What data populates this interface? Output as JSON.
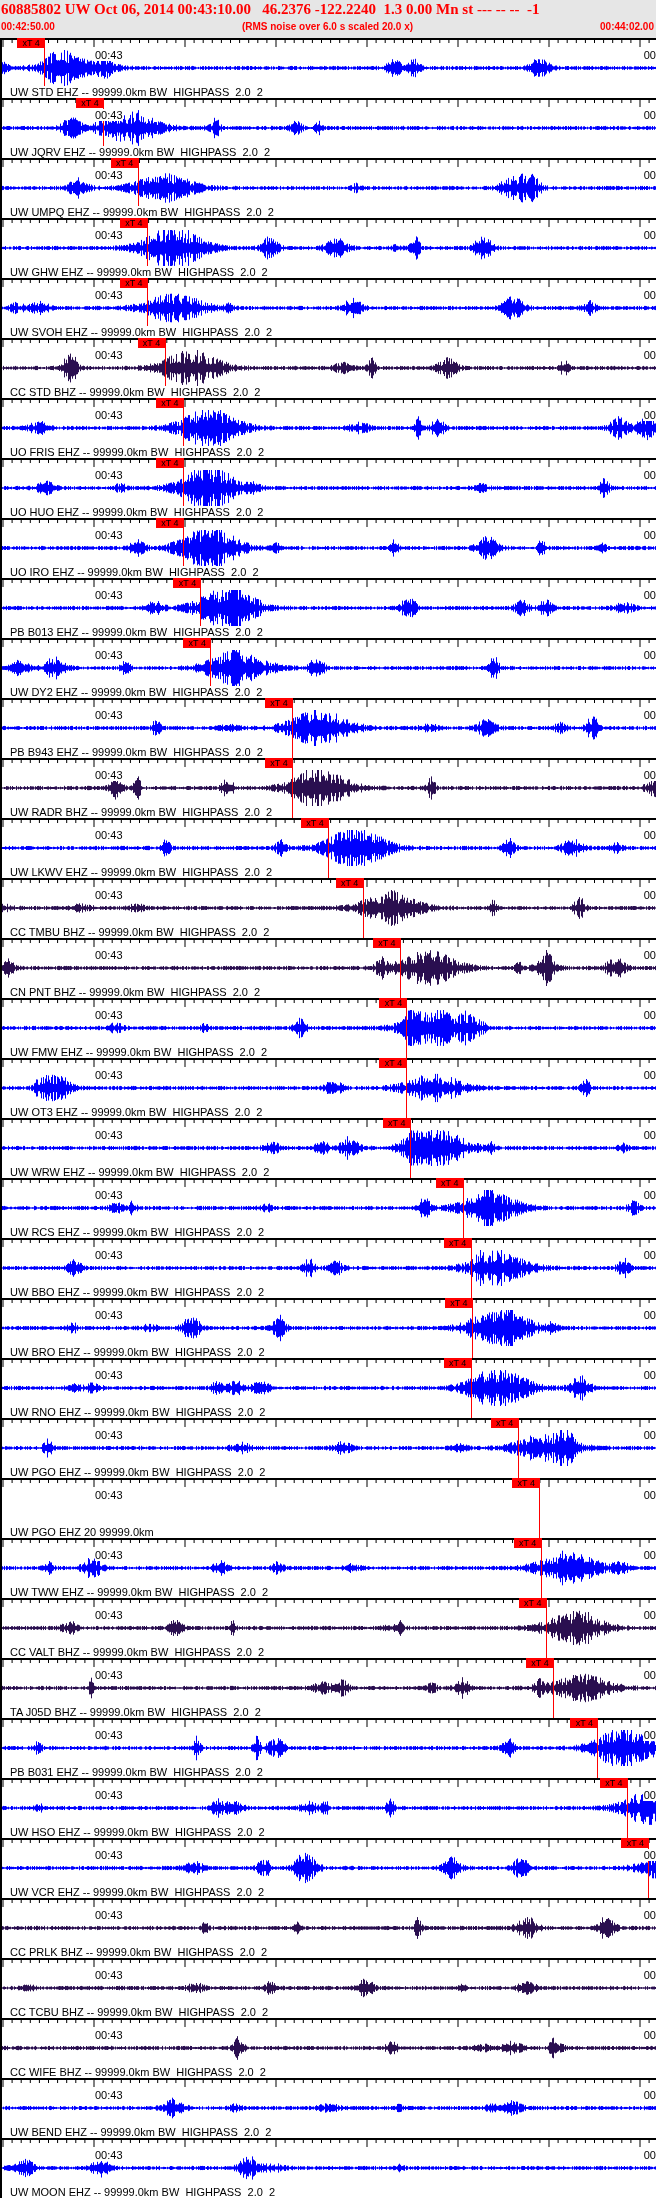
{
  "header": {
    "title": "60885802 UW Oct 06, 2014 00:43:10.00   46.2376 -122.2240  1.3 0.00 Mn st --- -- --  -1",
    "start_time": "00:42:50.00",
    "note": "(RMS noise over 6.0 s scaled 20.0 x)",
    "end_time": "00:44:02.00"
  },
  "traces": [
    {
      "label": "UW STD EHZ -- 99999.0km BW  HIGHPASS  2.0  2",
      "time_label": "00:43",
      "edge_label": "00",
      "kind": "wave",
      "color": "#0000ff",
      "pick": "xT 4",
      "level": 0.066
    },
    {
      "label": "UW JQRV EHZ -- 99999.0km BW  HIGHPASS  2.0  2",
      "time_label": "00:43",
      "edge_label": "00",
      "kind": "wave",
      "color": "#0000ff",
      "pick": "xT 4",
      "level": 0.156
    },
    {
      "label": "UW UMPQ EHZ -- 99999.0km BW  HIGHPASS  2.0  2",
      "time_label": "00:43",
      "edge_label": "00",
      "kind": "wave",
      "color": "#0000ff",
      "pick": "xT 4",
      "level": 0.209
    },
    {
      "label": "UW GHW EHZ -- 99999.0km BW  HIGHPASS  2.0  2",
      "time_label": "00:43",
      "edge_label": "00",
      "kind": "wave",
      "color": "#0000ff",
      "pick": "xT 4",
      "level": 0.223
    },
    {
      "label": "UW SVOH EHZ -- 99999.0km BW  HIGHPASS  2.0  2",
      "time_label": "00:43",
      "edge_label": "00",
      "kind": "wave",
      "color": "#0000ff",
      "pick": "xT 4",
      "level": 0.223
    },
    {
      "label": "CC STD BHZ -- 99999.0km BW  HIGHPASS  2.0  2",
      "time_label": "00:43",
      "edge_label": "00",
      "kind": "wave",
      "color": "#2a0f50",
      "pick": "xT 4",
      "level": 0.25
    },
    {
      "label": "UO FRIS EHZ -- 99999.0km BW  HIGHPASS  2.0  2",
      "time_label": "00:43",
      "edge_label": "00",
      "kind": "wave",
      "color": "#0000ff",
      "pick": "xT 4",
      "level": 0.278
    },
    {
      "label": "UO HUO EHZ -- 99999.0km BW  HIGHPASS  2.0  2",
      "time_label": "00:43",
      "edge_label": "00",
      "kind": "wave",
      "color": "#0000ff",
      "pick": "xT 4",
      "level": 0.278
    },
    {
      "label": "UO IRO EHZ -- 99999.0km BW  HIGHPASS  2.0  2",
      "time_label": "00:43",
      "edge_label": "00",
      "kind": "wave",
      "color": "#0000ff",
      "pick": "xT 4",
      "level": 0.278
    },
    {
      "label": "PB B013 EHZ -- 99999.0km BW  HIGHPASS  2.0  2",
      "time_label": "00:43",
      "edge_label": "00",
      "kind": "wave",
      "color": "#0000ff",
      "pick": "xT 4",
      "level": 0.305
    },
    {
      "label": "UW DY2 EHZ -- 99999.0km BW  HIGHPASS  2.0  2",
      "time_label": "00:43",
      "edge_label": "00",
      "kind": "wave",
      "color": "#0000ff",
      "pick": "xT 4",
      "level": 0.32
    },
    {
      "label": "PB B943 EHZ -- 99999.0km BW  HIGHPASS  2.0  2",
      "time_label": "00:43",
      "edge_label": "00",
      "kind": "wave",
      "color": "#0000ff",
      "pick": "xT 4",
      "level": 0.445
    },
    {
      "label": "UW RADR BHZ -- 99999.0km BW  HIGHPASS  2.0  2",
      "time_label": "00:43",
      "edge_label": "00",
      "kind": "wave",
      "color": "#2a0f50",
      "pick": "xT 4",
      "level": 0.445
    },
    {
      "label": "UW LKWV EHZ -- 99999.0km BW  HIGHPASS  2.0  2",
      "time_label": "00:43",
      "edge_label": "00",
      "kind": "wave",
      "color": "#0000ff",
      "pick": "xT 4",
      "level": 0.5
    },
    {
      "label": "CC TMBU BHZ -- 99999.0km BW  HIGHPASS  2.0  2",
      "time_label": "00:43",
      "edge_label": "00",
      "kind": "wave",
      "color": "#2a0f50",
      "pick": "xT 4",
      "level": 0.553
    },
    {
      "label": "CN PNT BHZ -- 99999.0km BW  HIGHPASS  2.0  2",
      "time_label": "00:43",
      "edge_label": "00",
      "kind": "wave",
      "color": "#2a0f50",
      "pick": "xT 4",
      "level": 0.61
    },
    {
      "label": "UW FMW EHZ -- 99999.0km BW  HIGHPASS  2.0  2",
      "time_label": "00:43",
      "edge_label": "00",
      "kind": "wave",
      "color": "#0000ff",
      "pick": "xT 4",
      "level": 0.62
    },
    {
      "label": "UW OT3 EHZ -- 99999.0km BW  HIGHPASS  2.0  2",
      "time_label": "00:43",
      "edge_label": "00",
      "kind": "wave",
      "color": "#0000ff",
      "pick": "xT 4",
      "level": 0.62
    },
    {
      "label": "UW WRW EHZ -- 99999.0km BW  HIGHPASS  2.0  2",
      "time_label": "00:43",
      "edge_label": "00",
      "kind": "wave",
      "color": "#0000ff",
      "pick": "xT 4",
      "level": 0.625
    },
    {
      "label": "UW RCS EHZ -- 99999.0km BW  HIGHPASS  2.0  2",
      "time_label": "00:43",
      "edge_label": "00",
      "kind": "wave",
      "color": "#0000ff",
      "pick": "xT 4",
      "level": 0.706
    },
    {
      "label": "UW BBO EHZ -- 99999.0km BW  HIGHPASS  2.0  2",
      "time_label": "00:43",
      "edge_label": "00",
      "kind": "wave",
      "color": "#0000ff",
      "pick": "xT 4",
      "level": 0.718
    },
    {
      "label": "UW BRO EHZ -- 99999.0km BW  HIGHPASS  2.0  2",
      "time_label": "00:43",
      "edge_label": "00",
      "kind": "wave",
      "color": "#0000ff",
      "pick": "xT 4",
      "level": 0.72
    },
    {
      "label": "UW RNO EHZ -- 99999.0km BW  HIGHPASS  2.0  2",
      "time_label": "00:43",
      "edge_label": "00",
      "kind": "wave",
      "color": "#0000ff",
      "pick": "xT 4",
      "level": 0.718
    },
    {
      "label": "UW PGO EHZ -- 99999.0km BW  HIGHPASS  2.0  2",
      "time_label": "00:43",
      "edge_label": "00",
      "kind": "wave",
      "color": "#0000ff",
      "pick": "xT 4",
      "level": 0.79
    },
    {
      "label": "UW PGO EHZ 20 99999.0km",
      "time_label": "00:43",
      "edge_label": "00",
      "kind": "empty",
      "pick": "xT 4",
      "level": 0.823
    },
    {
      "label": "UW TWW EHZ -- 99999.0km BW  HIGHPASS  2.0  2",
      "time_label": "00:43",
      "edge_label": "00",
      "kind": "wave",
      "color": "#0000ff",
      "pick": "xT 4",
      "level": 0.825
    },
    {
      "label": "CC VALT BHZ -- 99999.0km BW  HIGHPASS  2.0  2",
      "time_label": "00:43",
      "edge_label": "00",
      "kind": "wave",
      "color": "#2a0f50",
      "pick": "xT 4",
      "level": 0.833
    },
    {
      "label": "TA J05D BHZ -- 99999.0km BW  HIGHPASS  2.0  2",
      "time_label": "00:43",
      "edge_label": "00",
      "kind": "wave",
      "color": "#2a0f50",
      "pick": "xT 4",
      "level": 0.844
    },
    {
      "label": "PB B031 EHZ -- 99999.0km BW  HIGHPASS  2.0  2",
      "time_label": "00:43",
      "edge_label": "00",
      "kind": "wave",
      "color": "#0000ff",
      "pick": "xT 4",
      "level": 0.912
    },
    {
      "label": "UW HSO EHZ -- 99999.0km BW  HIGHPASS  2.0  2",
      "time_label": "00:43",
      "edge_label": "00",
      "kind": "wave",
      "color": "#0000ff",
      "pick": "xT 4",
      "level": 0.957
    },
    {
      "label": "UW VCR EHZ -- 99999.0km BW  HIGHPASS  2.0  2",
      "time_label": "00:43",
      "edge_label": "00",
      "kind": "wave",
      "color": "#0000ff",
      "pick": "xT 4",
      "level": 0.99
    },
    {
      "label": "CC PRLK BHZ -- 99999.0km BW  HIGHPASS  2.0  2",
      "time_label": "00:43",
      "edge_label": "00",
      "kind": "wave",
      "color": "#2a0f50"
    },
    {
      "label": "CC TCBU BHZ -- 99999.0km BW  HIGHPASS  2.0  2",
      "time_label": "00:43",
      "edge_label": "00",
      "kind": "wave",
      "color": "#2a0f50"
    },
    {
      "label": "CC WIFE BHZ -- 99999.0km BW  HIGHPASS  2.0  2",
      "time_label": "00:43",
      "edge_label": "00",
      "kind": "wave",
      "color": "#2a0f50"
    },
    {
      "label": "UW BEND EHZ -- 99999.0km BW  HIGHPASS  2.0  2",
      "time_label": "00:43",
      "edge_label": "00",
      "kind": "wave",
      "color": "#0000ff"
    },
    {
      "label": "UW MOON EHZ -- 99999.0km BW  HIGHPASS  2.0  2",
      "time_label": "00:43",
      "edge_label": "00",
      "kind": "wave",
      "color": "#0000ff"
    }
  ]
}
